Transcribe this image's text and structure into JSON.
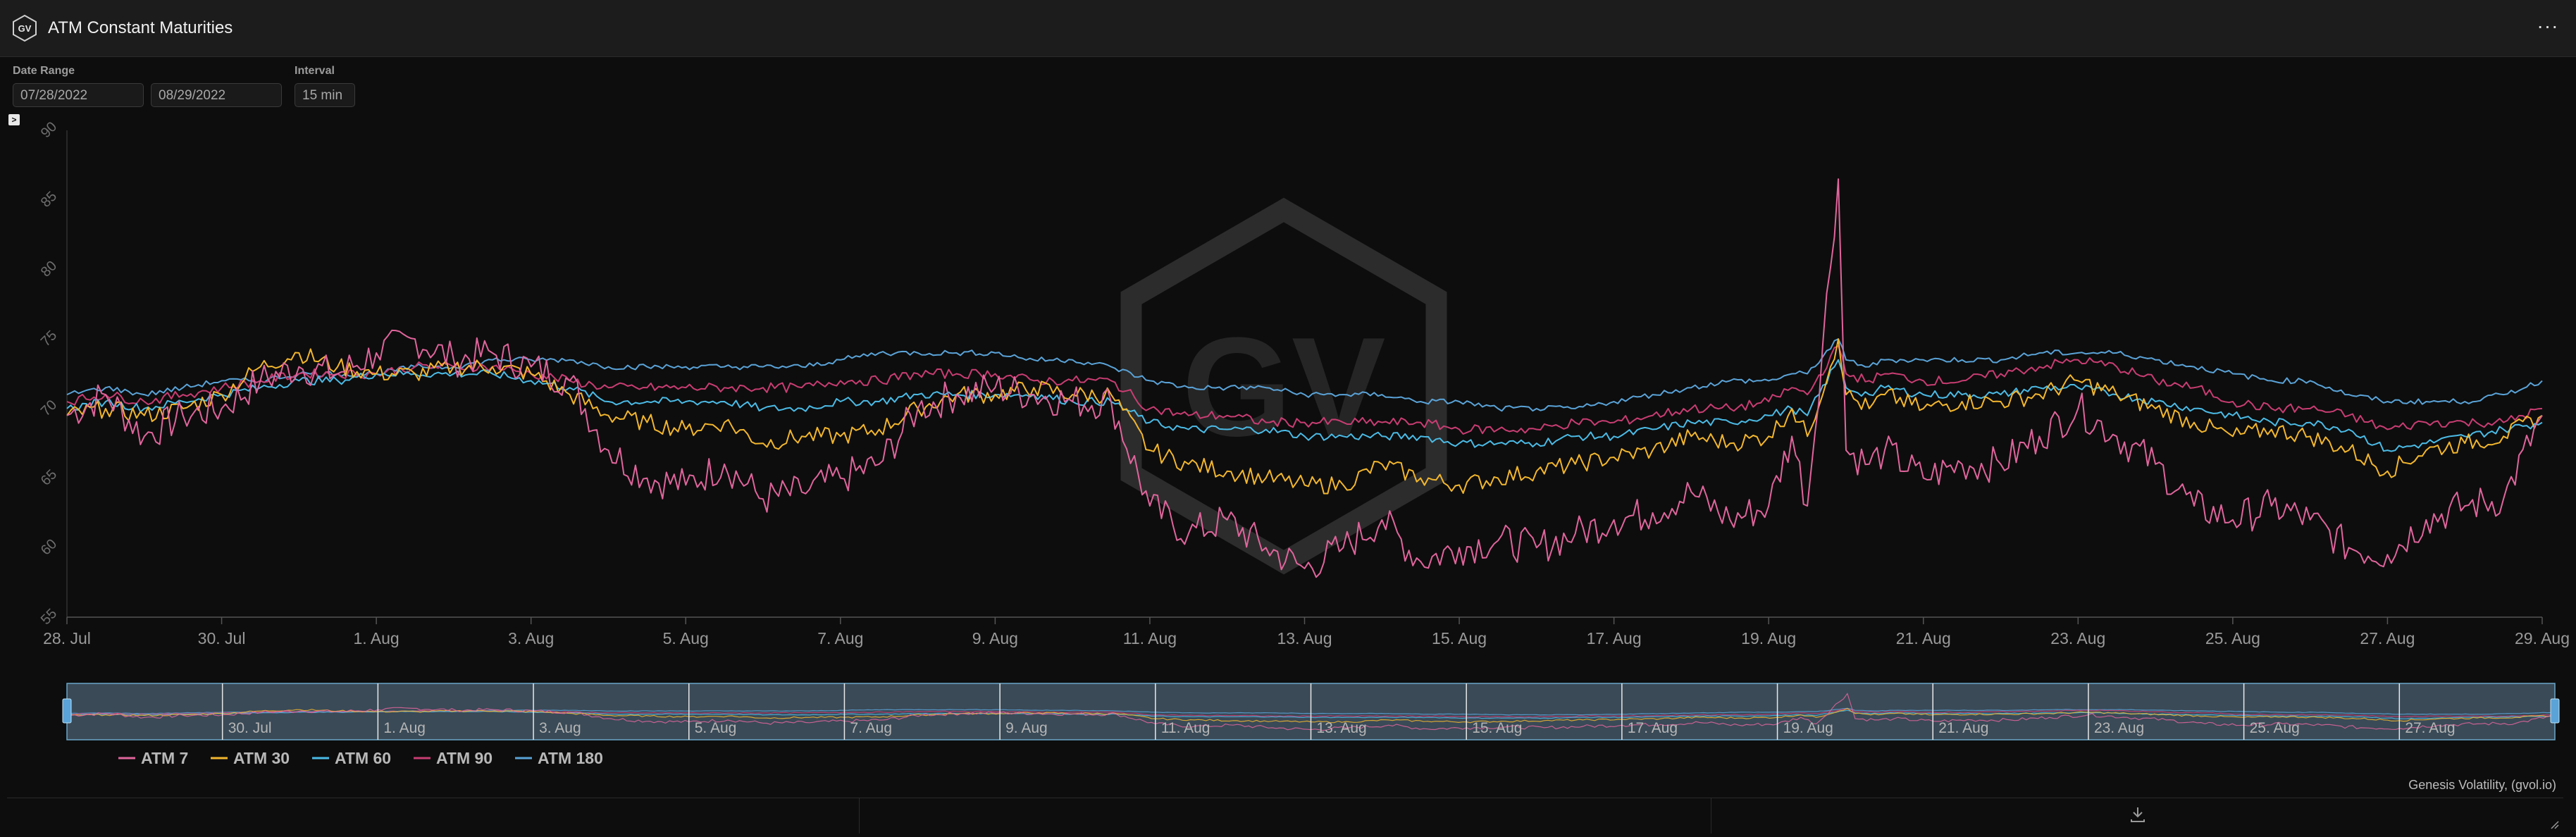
{
  "header": {
    "logo_text": "GV",
    "title": "ATM Constant Maturities",
    "menu_label": "···"
  },
  "controls": {
    "date_range_label": "Date Range",
    "start_date": "07/28/2022",
    "end_date": "08/29/2022",
    "interval_label": "Interval",
    "interval_value": "15 min"
  },
  "collapse_label": ">",
  "credit": "Genesis Volatility, (gvol.io)",
  "watermark": "GV",
  "colors": {
    "atm7": "#e0659c",
    "atm30": "#f2b62e",
    "atm60": "#4bbbe6",
    "atm90": "#c93d72",
    "atm180": "#5aa3d8"
  },
  "chart_data": {
    "type": "line",
    "ylim": [
      55,
      90
    ],
    "yticks": [
      55,
      60,
      65,
      70,
      75,
      80,
      85,
      90
    ],
    "x_start_day": 28,
    "x_end_day": 60,
    "xticks": [
      {
        "day": 28,
        "label": "28. Jul"
      },
      {
        "day": 30,
        "label": "30. Jul"
      },
      {
        "day": 32,
        "label": "1. Aug"
      },
      {
        "day": 34,
        "label": "3. Aug"
      },
      {
        "day": 36,
        "label": "5. Aug"
      },
      {
        "day": 38,
        "label": "7. Aug"
      },
      {
        "day": 40,
        "label": "9. Aug"
      },
      {
        "day": 42,
        "label": "11. Aug"
      },
      {
        "day": 44,
        "label": "13. Aug"
      },
      {
        "day": 46,
        "label": "15. Aug"
      },
      {
        "day": 48,
        "label": "17. Aug"
      },
      {
        "day": 50,
        "label": "19. Aug"
      },
      {
        "day": 52,
        "label": "21. Aug"
      },
      {
        "day": 54,
        "label": "23. Aug"
      },
      {
        "day": 56,
        "label": "25. Aug"
      },
      {
        "day": 58,
        "label": "27. Aug"
      },
      {
        "day": 60,
        "label": "29. Aug"
      }
    ],
    "navigator_ticks": [
      {
        "day": 30,
        "label": "30. Jul"
      },
      {
        "day": 32,
        "label": "1. Aug"
      },
      {
        "day": 34,
        "label": "3. Aug"
      },
      {
        "day": 36,
        "label": "5. Aug"
      },
      {
        "day": 38,
        "label": "7. Aug"
      },
      {
        "day": 40,
        "label": "9. Aug"
      },
      {
        "day": 42,
        "label": "11. Aug"
      },
      {
        "day": 44,
        "label": "13. Aug"
      },
      {
        "day": 46,
        "label": "15. Aug"
      },
      {
        "day": 48,
        "label": "17. Aug"
      },
      {
        "day": 50,
        "label": "19. Aug"
      },
      {
        "day": 52,
        "label": "21. Aug"
      },
      {
        "day": 54,
        "label": "23. Aug"
      },
      {
        "day": 56,
        "label": "25. Aug"
      },
      {
        "day": 58,
        "label": "27. Aug"
      }
    ],
    "legend_position": "bottom-left",
    "series": [
      {
        "name": "ATM 7",
        "color": "#e0659c",
        "x": [
          28,
          28.5,
          29,
          29.5,
          30,
          30.5,
          31,
          31.5,
          32,
          32.5,
          33,
          33.5,
          34,
          34.5,
          35,
          35.5,
          36,
          36.5,
          37,
          37.5,
          38,
          38.5,
          39,
          39.5,
          40,
          40.5,
          41,
          41.5,
          42,
          42.5,
          43,
          43.5,
          44,
          44.5,
          45,
          45.5,
          46,
          46.5,
          47,
          47.5,
          48,
          48.5,
          49,
          49.5,
          50,
          50.3,
          50.5,
          50.9,
          51,
          51.3,
          51.5,
          52,
          52.5,
          53,
          53.5,
          54,
          54.5,
          55,
          55.5,
          56,
          56.5,
          57,
          57.5,
          58,
          58.5,
          59,
          59.5,
          60
        ],
        "y": [
          69.5,
          71,
          68,
          69.5,
          70,
          72,
          73,
          72.5,
          74,
          75,
          73.5,
          74,
          73,
          72,
          67,
          65,
          64.5,
          66,
          63.5,
          64,
          65,
          66,
          70,
          71,
          71.5,
          71,
          70.5,
          70.5,
          63,
          61,
          62,
          60,
          58.5,
          60,
          62,
          59,
          60,
          60.5,
          60,
          61,
          62,
          62.5,
          64,
          62,
          63,
          68,
          63,
          86.5,
          67,
          66,
          67,
          65,
          66,
          66,
          68,
          70,
          68,
          66,
          63,
          62,
          63,
          62,
          60,
          59.5,
          62,
          63,
          63.5,
          69.5
        ]
      },
      {
        "name": "ATM 30",
        "color": "#f2b62e",
        "x": [
          28,
          28.5,
          29,
          29.5,
          30,
          30.5,
          31,
          31.5,
          32,
          32.5,
          33,
          33.5,
          34,
          34.5,
          35,
          35.5,
          36,
          36.5,
          37,
          37.5,
          38,
          38.5,
          39,
          39.5,
          40,
          40.5,
          41,
          41.5,
          42,
          42.5,
          43,
          43.5,
          44,
          44.5,
          45,
          45.5,
          46,
          46.5,
          47,
          47.5,
          48,
          48.5,
          49,
          49.5,
          50,
          50.3,
          50.5,
          50.9,
          51,
          51.3,
          51.5,
          52,
          52.5,
          53,
          53.5,
          54,
          54.5,
          55,
          55.5,
          56,
          56.5,
          57,
          57.5,
          58,
          58.5,
          59,
          59.5,
          60
        ],
        "y": [
          69.5,
          70,
          69.5,
          70,
          71,
          73,
          74,
          73,
          72.5,
          72.5,
          73,
          73,
          72.5,
          71,
          69.5,
          69,
          68.5,
          69,
          67.5,
          68,
          68,
          68.5,
          70,
          71,
          71,
          71.5,
          71,
          71,
          67,
          66,
          65.5,
          65,
          64.5,
          64.5,
          66,
          65,
          64.5,
          65,
          65.5,
          66,
          66.5,
          67,
          68,
          67.5,
          68,
          70,
          68,
          75,
          71,
          70,
          71,
          70,
          70.5,
          70.5,
          71,
          72,
          71,
          70,
          69,
          68,
          68.5,
          68,
          67,
          65.5,
          67,
          67.5,
          68,
          69.5
        ]
      },
      {
        "name": "ATM 60",
        "color": "#4bbbe6",
        "x": [
          28,
          28.5,
          29,
          29.5,
          30,
          30.5,
          31,
          31.5,
          32,
          32.5,
          33,
          33.5,
          34,
          34.5,
          35,
          35.5,
          36,
          36.5,
          37,
          37.5,
          38,
          38.5,
          39,
          39.5,
          40,
          40.5,
          41,
          41.5,
          42,
          42.5,
          43,
          43.5,
          44,
          44.5,
          45,
          45.5,
          46,
          46.5,
          47,
          47.5,
          48,
          48.5,
          49,
          49.5,
          50,
          50.3,
          50.5,
          50.9,
          51,
          51.3,
          51.5,
          52,
          52.5,
          53,
          53.5,
          54,
          54.5,
          55,
          55.5,
          56,
          56.5,
          57,
          57.5,
          58,
          58.5,
          59,
          59.5,
          60
        ],
        "y": [
          70,
          70.5,
          70,
          70.5,
          71,
          71.5,
          72,
          72,
          72.5,
          72.5,
          72.5,
          72.5,
          72,
          71.5,
          70.5,
          70.5,
          70.5,
          70.5,
          70,
          70,
          70.5,
          70.5,
          71,
          71,
          71,
          71,
          70.5,
          70.5,
          69,
          68.5,
          68.5,
          68.5,
          68,
          68,
          68,
          68,
          67.5,
          67.5,
          67.5,
          68,
          68,
          68.5,
          69,
          69,
          69.5,
          70,
          69.5,
          73.5,
          71.5,
          71,
          71.5,
          71,
          71,
          71,
          71.5,
          71.5,
          71,
          70.5,
          70,
          69.5,
          69,
          69,
          68.5,
          67,
          67.5,
          68,
          68.5,
          69
        ]
      },
      {
        "name": "ATM 90",
        "color": "#c93d72",
        "x": [
          28,
          28.5,
          29,
          29.5,
          30,
          30.5,
          31,
          31.5,
          32,
          32.5,
          33,
          33.5,
          34,
          34.5,
          35,
          35.5,
          36,
          36.5,
          37,
          37.5,
          38,
          38.5,
          39,
          39.5,
          40,
          40.5,
          41,
          41.5,
          42,
          42.5,
          43,
          43.5,
          44,
          44.5,
          45,
          45.5,
          46,
          46.5,
          47,
          47.5,
          48,
          48.5,
          49,
          49.5,
          50,
          50.3,
          50.5,
          50.9,
          51,
          51.3,
          51.5,
          52,
          52.5,
          53,
          53.5,
          54,
          54.5,
          55,
          55.5,
          56,
          56.5,
          57,
          57.5,
          58,
          58.5,
          59,
          59.5,
          60
        ],
        "y": [
          70.5,
          71,
          70.5,
          71,
          71.5,
          72,
          72.5,
          72.5,
          72.5,
          73,
          73,
          73,
          72.5,
          72,
          71.5,
          71.5,
          71.5,
          71.5,
          71.5,
          71.5,
          72,
          72,
          72.5,
          72.5,
          72.5,
          72,
          72,
          72,
          70,
          69.5,
          69.5,
          69,
          69,
          69,
          69,
          69,
          68.5,
          68.5,
          68.5,
          69,
          69,
          69.5,
          70,
          70,
          70.5,
          71.5,
          71,
          74.5,
          72.5,
          72,
          72.5,
          72,
          72,
          72.5,
          73,
          73.5,
          73,
          72,
          71.5,
          70.5,
          70,
          70,
          69.5,
          68.5,
          69,
          69,
          69,
          70
        ]
      },
      {
        "name": "ATM 180",
        "color": "#5aa3d8",
        "x": [
          28,
          28.5,
          29,
          29.5,
          30,
          30.5,
          31,
          31.5,
          32,
          32.5,
          33,
          33.5,
          34,
          34.5,
          35,
          35.5,
          36,
          36.5,
          37,
          37.5,
          38,
          38.5,
          39,
          39.5,
          40,
          40.5,
          41,
          41.5,
          42,
          42.5,
          43,
          43.5,
          44,
          44.5,
          45,
          45.5,
          46,
          46.5,
          47,
          47.5,
          48,
          48.5,
          49,
          49.5,
          50,
          50.3,
          50.5,
          50.9,
          51,
          51.3,
          51.5,
          52,
          52.5,
          53,
          53.5,
          54,
          54.5,
          55,
          55.5,
          56,
          56.5,
          57,
          57.5,
          58,
          58.5,
          59,
          59.5,
          60
        ],
        "y": [
          71,
          71.5,
          71,
          71.5,
          72,
          72,
          72.5,
          72.5,
          72.5,
          73,
          73,
          73.5,
          73.5,
          73.5,
          73,
          73,
          73,
          73,
          73,
          73,
          73.5,
          74,
          74,
          74,
          74,
          73.5,
          73.5,
          73,
          72,
          71.5,
          71.5,
          71.5,
          71,
          71,
          71,
          70.5,
          70.5,
          70,
          70,
          70,
          70.5,
          71,
          71.5,
          72,
          72,
          72.5,
          72.5,
          75,
          73.5,
          73,
          73.5,
          73.5,
          73.5,
          73.5,
          74,
          74,
          74,
          73.5,
          73,
          72.5,
          72,
          72,
          71,
          70.5,
          70.5,
          70.5,
          71,
          72
        ]
      }
    ]
  }
}
